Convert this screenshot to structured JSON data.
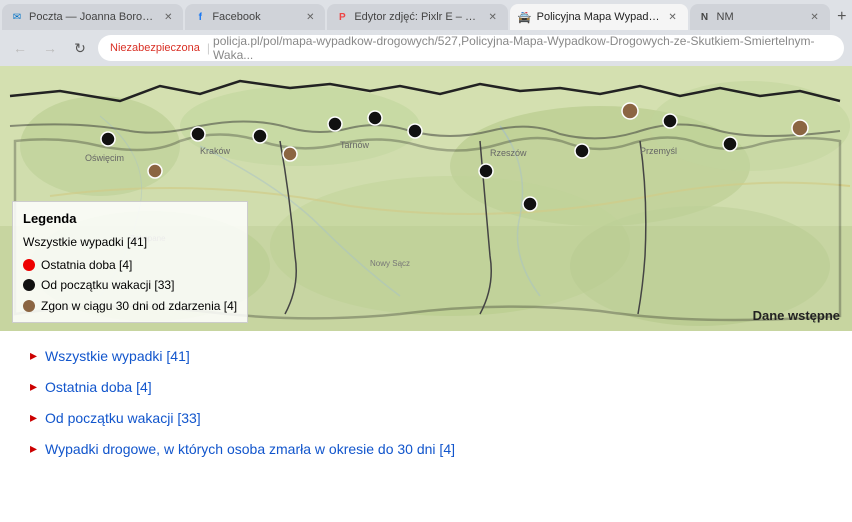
{
  "browser": {
    "tabs": [
      {
        "id": "tab-poczta",
        "label": "Poczta — Joanna Boroń — Outlo...",
        "favicon": "✉",
        "active": false,
        "faviconColor": "#0072c6"
      },
      {
        "id": "tab-facebook",
        "label": "Facebook",
        "favicon": "f",
        "active": false,
        "faviconColor": "#1877f2"
      },
      {
        "id": "tab-edytor",
        "label": "Edytor zdjęć: Pixlr E – bezpłatne ...",
        "favicon": "P",
        "active": false,
        "faviconColor": "#e44"
      },
      {
        "id": "tab-policyjna",
        "label": "Policyjna Mapa Wypadków Drog...",
        "favicon": "🚓",
        "active": true,
        "faviconColor": "#666"
      },
      {
        "id": "tab-nm",
        "label": "NM",
        "favicon": "N",
        "active": false,
        "faviconColor": "#333"
      }
    ],
    "address": {
      "secure_label": "Niezabezpieczona",
      "url_domain": "policja.pl",
      "url_path": "/pol/mapa-wypadkow-drogowych/527,Policyjna-Mapa-Wypadkow-Drogowych-ze-Skutkiem-Smiertelnym-Waka..."
    }
  },
  "legend": {
    "title": "Legenda",
    "all_accidents": "Wszystkie wypadki [41]",
    "recent": "Ostatnia doba [4]",
    "since_vacation": "Od początku wakacji [33]",
    "death_30": "Zgon w ciągu 30 dni od zdarzenia [4]",
    "dane_wstepne": "Dane wstępne"
  },
  "links": [
    {
      "text": "Wszystkie wypadki [41]"
    },
    {
      "text": "Ostatnia doba [4]"
    },
    {
      "text": "Od początku wakacji [33]"
    },
    {
      "text": "Wypadki drogowe, w których osoba zmarła w okresie do 30 dni [4]"
    }
  ],
  "colors": {
    "accent_red": "#cc0000",
    "map_green": "#c8d8a8",
    "map_border": "#333"
  }
}
